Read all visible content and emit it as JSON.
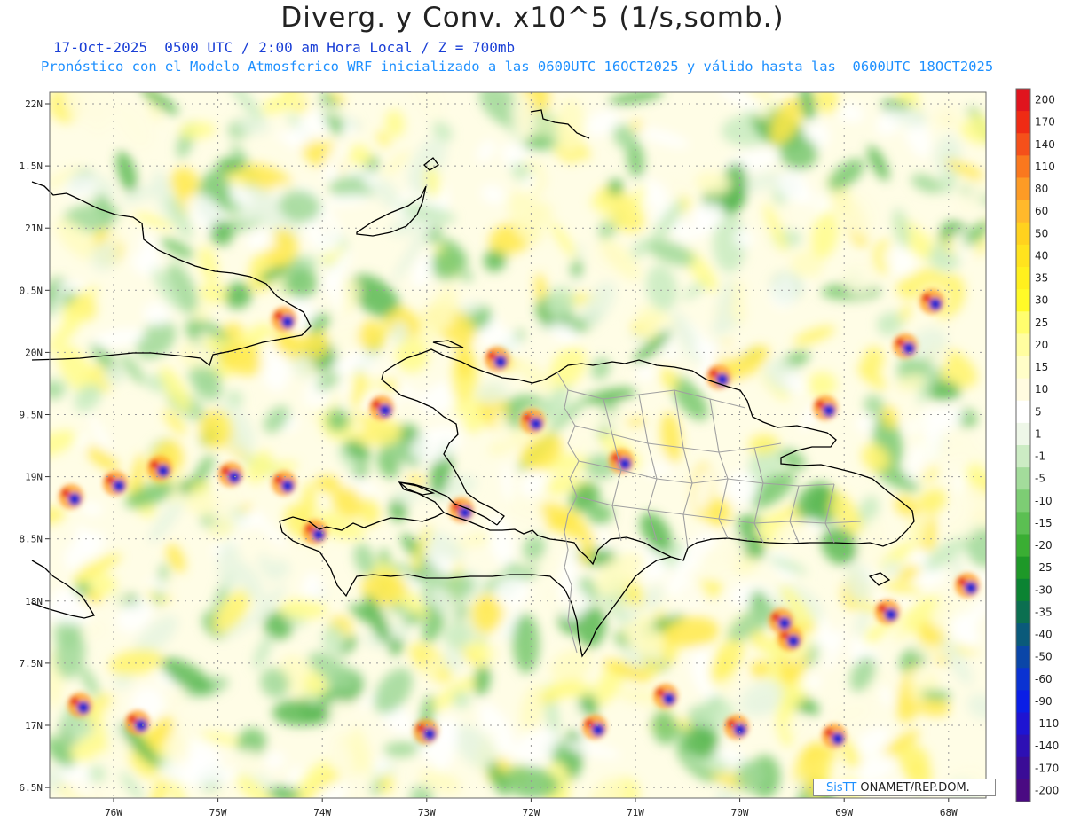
{
  "title": "Diverg. y Conv. x10^5 (1/s,somb.)",
  "subtitle_line1": "17-Oct-2025  0500 UTC / 2:00 am Hora Local / Z = 700mb",
  "subtitle_line2": "Pronóstico con el Modelo Atmosferico WRF inicializado a las 0600UTC_16OCT2025 y válido hasta las  0600UTC_18OCT2025",
  "credit": {
    "brand": "SisTT",
    "text": " ONAMET/REP.DOM."
  },
  "lat_labels": [
    "22N",
    "1.5N",
    "21N",
    "0.5N",
    "20N",
    "9.5N",
    "19N",
    "8.5N",
    "18N",
    "7.5N",
    "17N",
    "6.5N"
  ],
  "lon_labels": [
    "76W",
    "75W",
    "74W",
    "73W",
    "72W",
    "71W",
    "70W",
    "69W",
    "68W"
  ],
  "legend": {
    "labels": [
      "200",
      "170",
      "140",
      "110",
      "80",
      "60",
      "50",
      "40",
      "35",
      "30",
      "25",
      "20",
      "15",
      "10",
      "5",
      "1",
      "-1",
      "-5",
      "-10",
      "-15",
      "-20",
      "-25",
      "-30",
      "-35",
      "-40",
      "-50",
      "-60",
      "-90",
      "-110",
      "-140",
      "-170",
      "-200"
    ],
    "colors": [
      "#e0141e",
      "#ef2b14",
      "#f5501a",
      "#fa781e",
      "#fd9b25",
      "#ffb92b",
      "#ffd21e",
      "#ffe31e",
      "#fff01e",
      "#fffa28",
      "#fffe6e",
      "#fffea0",
      "#fffec8",
      "#fffbe0",
      "#ffffff",
      "#eef7e8",
      "#ccecc4",
      "#a3dc9b",
      "#7dcd74",
      "#5bbf52",
      "#3aae33",
      "#1e9828",
      "#0b8332",
      "#0b6f50",
      "#0a5a7a",
      "#0a46a8",
      "#0a32d2",
      "#0a1ee6",
      "#1e14d2",
      "#2d10b4",
      "#3a0c96",
      "#4a0a82"
    ]
  },
  "colors": {
    "land_line": "#000000",
    "province_line": "#a0a0a0",
    "grid": "#888888"
  }
}
